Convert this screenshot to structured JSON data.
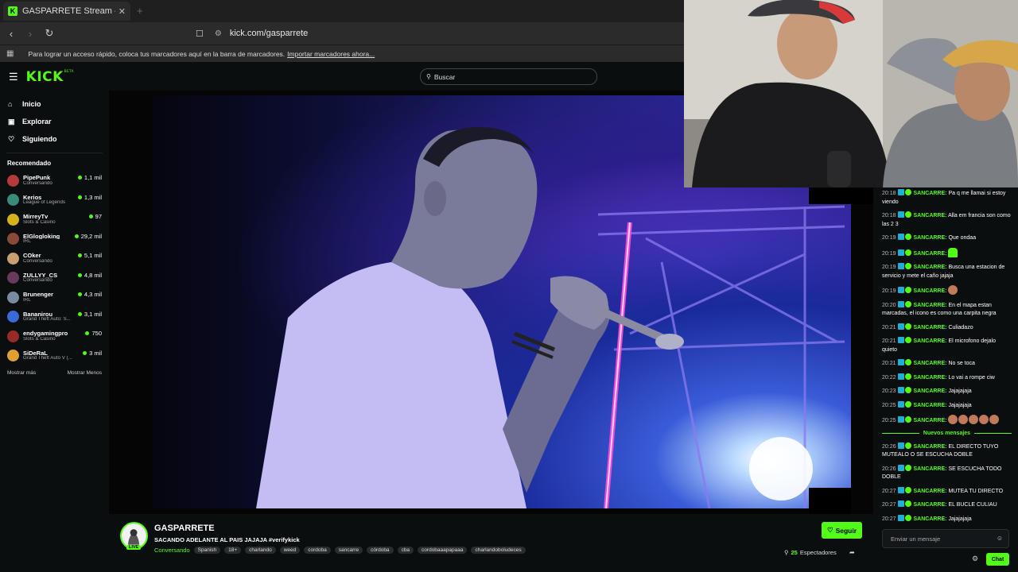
{
  "browser": {
    "tab_title": "GASPARRETE Stream - Watch Li",
    "tab_close": "✕",
    "new_tab": "+",
    "url": "kick.com/gasparrete",
    "bookmarks_text": "Para lograr un acceso rápido, coloca tus marcadores aquí en la barra de marcadores.",
    "bookmarks_link": "Importar marcadores ahora..."
  },
  "header": {
    "logo": "KICK",
    "logo_beta": "BETA",
    "search_placeholder": "Buscar"
  },
  "sidebar": {
    "nav": [
      {
        "label": "Inicio",
        "icon": "home-icon"
      },
      {
        "label": "Explorar",
        "icon": "compass-icon"
      },
      {
        "label": "Siguiendo",
        "icon": "heart-icon"
      }
    ],
    "recommended_title": "Recomendado",
    "recommended": [
      {
        "name": "PipePunk",
        "category": "Conversando",
        "viewers": "1,1 mil",
        "color": "#b23a3a"
      },
      {
        "name": "Kerios",
        "category": "League of Legends",
        "viewers": "1,3 mil",
        "color": "#3a8a7a"
      },
      {
        "name": "MirreyTv",
        "category": "Slots & Casino",
        "viewers": "97",
        "color": "#d4b21c"
      },
      {
        "name": "ElGlogloking",
        "category": "IRL",
        "viewers": "29,2 mil",
        "color": "#8a4a3a"
      },
      {
        "name": "COker",
        "category": "Conversando",
        "viewers": "5,1 mil",
        "color": "#c8a070"
      },
      {
        "name": "ZULLYY_CS",
        "category": "Conversando",
        "viewers": "4,8 mil",
        "color": "#6a3a5a"
      },
      {
        "name": "Brunenger",
        "category": "IRL",
        "viewers": "4,3 mil",
        "color": "#7a8aa0"
      },
      {
        "name": "Bananirou",
        "category": "Grand Theft Auto: S...",
        "viewers": "3,1 mil",
        "color": "#3a6ad8"
      },
      {
        "name": "endygamingpro",
        "category": "Slots & Casino",
        "viewers": "750",
        "color": "#9a2a2a"
      },
      {
        "name": "SiDeRaL",
        "category": "Grand Theft Auto V (...",
        "viewers": "3 mil",
        "color": "#e0a030"
      }
    ],
    "show_more": "Mostrar más",
    "show_less": "Mostrar Menos"
  },
  "stream": {
    "channel": "GASPARRETE",
    "title": "SACANDO ADELANTE AL PAIS JAJAJA #verifykick",
    "category": "Conversando",
    "tags": [
      "Spanish",
      "18+",
      "charlando",
      "weed",
      "cordoba",
      "sancarre",
      "córdoba",
      "cba",
      "cordobaaapapaaa",
      "charlandoboludeces"
    ],
    "live_badge": "LIVE",
    "follow_label": "Seguir",
    "viewers": "25",
    "viewers_label": "Espectadores"
  },
  "chat": {
    "messages": [
      {
        "time": "20:18",
        "user": "SANCARRE",
        "text": "Pa q me llamai si estoy viendo"
      },
      {
        "time": "20:18",
        "user": "SANCARRE",
        "text": "Alla em francia son como las 2 3"
      },
      {
        "time": "20:19",
        "user": "SANCARRE",
        "text": "Que ondaa"
      },
      {
        "time": "20:19",
        "user": "SANCARRE",
        "text": "",
        "emotes": 1,
        "emote_style": "green"
      },
      {
        "time": "20:19",
        "user": "SANCARRE",
        "text": "Busca una estacion de servicio y mete el caño jajaja"
      },
      {
        "time": "20:19",
        "user": "SANCARRE",
        "text": "",
        "emotes": 1,
        "emote_style": "face"
      },
      {
        "time": "20:20",
        "user": "SANCARRE",
        "text": "En el mapa estan marcadas, el icono es como una carpita negra"
      },
      {
        "time": "20:21",
        "user": "SANCARRE",
        "text": "Culiadazo"
      },
      {
        "time": "20:21",
        "user": "SANCARRE",
        "text": "El microfono dejalo quieto"
      },
      {
        "time": "20:21",
        "user": "SANCARRE",
        "text": "No se toca"
      },
      {
        "time": "20:22",
        "user": "SANCARRE",
        "text": "Lo vai a rompe ciw"
      },
      {
        "time": "20:23",
        "user": "SANCARRE",
        "text": "Jajajajaja"
      },
      {
        "time": "20:25",
        "user": "SANCARRE",
        "text": "Jajajajaja"
      },
      {
        "time": "20:25",
        "user": "SANCARRE",
        "text": "",
        "emotes": 5,
        "emote_style": "face"
      }
    ],
    "new_messages_label": "Nuevos mensajes",
    "new_messages": [
      {
        "time": "20:26",
        "user": "SANCARRE",
        "text": "EL DIRECTO TUYO MUTEALO O SE ESCUCHA DOBLE"
      },
      {
        "time": "20:26",
        "user": "SANCARRE",
        "text": "SE ESCUCHA TODO DOBLE"
      },
      {
        "time": "20:27",
        "user": "SANCARRE",
        "text": "MUTEA TU DIRECTO"
      },
      {
        "time": "20:27",
        "user": "SANCARRE",
        "text": "EL BUCLE CULIAU"
      },
      {
        "time": "20:27",
        "user": "SANCARRE",
        "text": "Jajajajaja"
      }
    ],
    "input_placeholder": "Enviar un mensaje",
    "send_label": "Chat"
  }
}
